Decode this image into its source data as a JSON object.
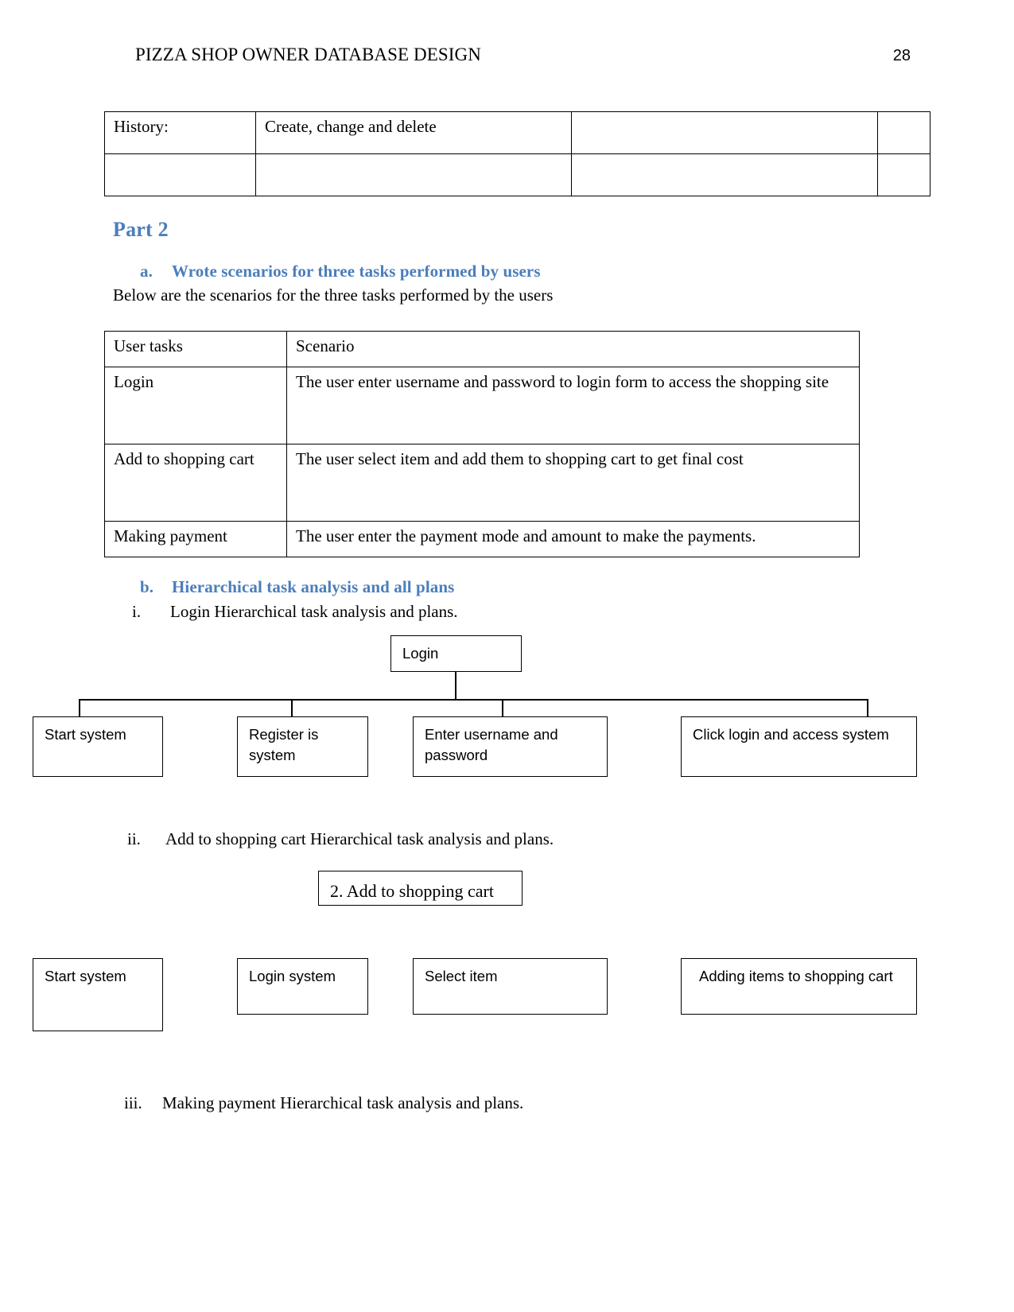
{
  "header": {
    "title": "PIZZA SHOP OWNER DATABASE DESIGN",
    "page_number": "28"
  },
  "history_table": {
    "rows": [
      [
        "History:",
        "Create, change and delete",
        "",
        ""
      ],
      [
        "",
        "",
        "",
        ""
      ]
    ]
  },
  "part2": {
    "heading": "Part 2",
    "item_a": {
      "marker": "a.",
      "label": "Wrote scenarios for three tasks performed by users"
    },
    "intro": "Below are the scenarios for the three tasks performed by the users",
    "item_b": {
      "marker": "b.",
      "label": "Hierarchical task analysis and all plans"
    }
  },
  "scenario_table": {
    "headers": [
      "User tasks",
      "Scenario"
    ],
    "rows": [
      {
        "task": "Login",
        "scenario": "The user enter username and password to login form to access the shopping site"
      },
      {
        "task": "Add to shopping cart",
        "scenario": "The user select item and add them to shopping cart to get final cost"
      },
      {
        "task": "Making payment",
        "scenario": "The user enter the payment mode and amount to make the payments."
      }
    ]
  },
  "sub_items": {
    "i": {
      "marker": "i.",
      "text": "Login Hierarchical task analysis and plans."
    },
    "ii": {
      "marker": "ii.",
      "text": "Add to shopping cart Hierarchical task analysis and plans."
    },
    "iii": {
      "marker": "iii.",
      "text": "Making payment Hierarchical task analysis and plans."
    }
  },
  "diagram_login": {
    "root": "Login",
    "children": [
      "Start system",
      "Register is system",
      "Enter username and password",
      "Click login and access system"
    ]
  },
  "diagram_cart": {
    "root": "2. Add to shopping cart",
    "children": [
      "Start system",
      "Login system",
      "Select item",
      "Adding items to shopping cart"
    ]
  },
  "colors": {
    "heading_blue": "#4a7ebb",
    "text_black": "#000000",
    "page_background": "#ffffff",
    "rule_black": "#000000"
  }
}
